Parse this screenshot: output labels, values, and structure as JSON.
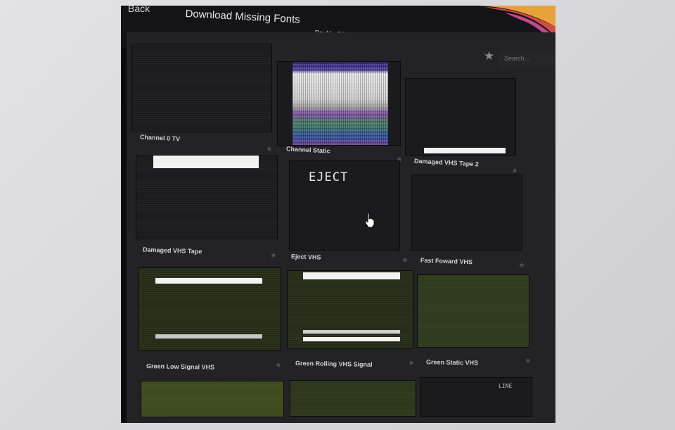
{
  "toolbar": {
    "back_label": "Back",
    "download_missing_fonts_label": "Download Missing Fonts",
    "hint_text": "Double-Click a Preset to Add",
    "search_placeholder": "Search..."
  },
  "presets": [
    {
      "name": "Channel 0 TV",
      "thumbnail": "dark"
    },
    {
      "name": "Channel Static",
      "thumbnail": "color-static"
    },
    {
      "name": "Damaged VHS Tape 2",
      "thumbnail": "dark"
    },
    {
      "name": "Damaged VHS Tape",
      "thumbnail": "dark"
    },
    {
      "name": "Eject VHS",
      "thumbnail": "dark",
      "overlay_text": "EJECT"
    },
    {
      "name": "Fast Foward VHS",
      "thumbnail": "dark"
    },
    {
      "name": "Green Low Signal VHS",
      "thumbnail": "green"
    },
    {
      "name": "Green Rolling VHS Signal",
      "thumbnail": "green"
    },
    {
      "name": "Green Static VHS",
      "thumbnail": "green"
    }
  ],
  "partial_row_text": "LINE",
  "colors": {
    "screen_bg": "#0c0c0d",
    "panel_bg": "#232326",
    "swoosh_orange": "#e8a23a",
    "swoosh_red": "#d24a4a",
    "swoosh_pink": "#c04a8a"
  },
  "icons": {
    "favorite": "star-icon",
    "cursor": "hand-cursor-icon"
  }
}
